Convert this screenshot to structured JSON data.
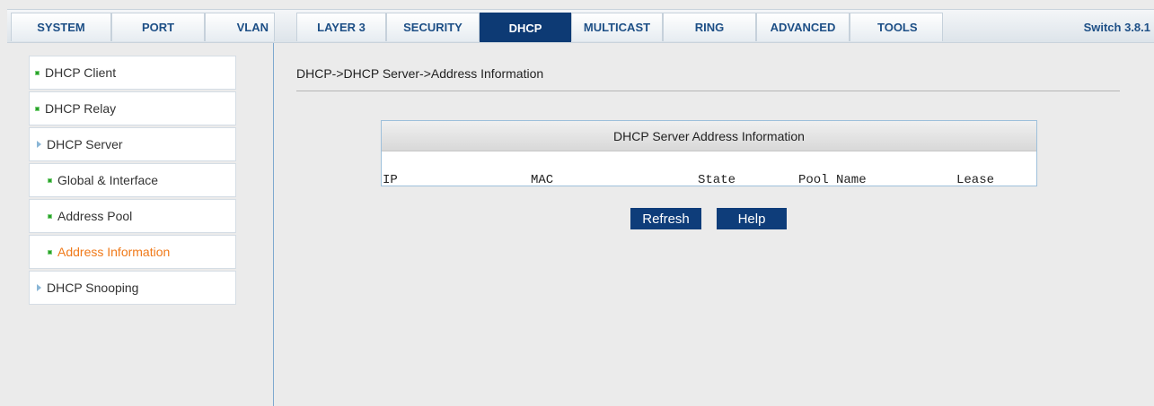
{
  "nav": {
    "tabs": [
      {
        "label": "SYSTEM"
      },
      {
        "label": "PORT"
      },
      {
        "label": "VLAN"
      },
      {
        "label": "LAYER 3"
      },
      {
        "label": "SECURITY"
      },
      {
        "label": "DHCP",
        "active": true
      },
      {
        "label": "MULTICAST"
      },
      {
        "label": "RING"
      },
      {
        "label": "ADVANCED"
      },
      {
        "label": "TOOLS"
      }
    ],
    "version": "Switch 3.8.1"
  },
  "sidebar": {
    "items": [
      {
        "label": "DHCP Client"
      },
      {
        "label": "DHCP Relay"
      },
      {
        "label": "DHCP Server"
      },
      {
        "label": "Global & Interface"
      },
      {
        "label": "Address Pool"
      },
      {
        "label": "Address Information"
      },
      {
        "label": "DHCP Snooping"
      }
    ]
  },
  "main": {
    "breadcrumb": "DHCP->DHCP Server->Address Information",
    "table": {
      "title": "DHCP Server Address Information",
      "columns": [
        "IP",
        "MAC",
        "State",
        "Pool Name",
        "Lease"
      ]
    },
    "buttons": {
      "refresh": "Refresh",
      "help": "Help"
    }
  },
  "colors": {
    "accent": "#0d3a74",
    "current_item": "#f07a1a",
    "bullet": "#2aa02a"
  }
}
